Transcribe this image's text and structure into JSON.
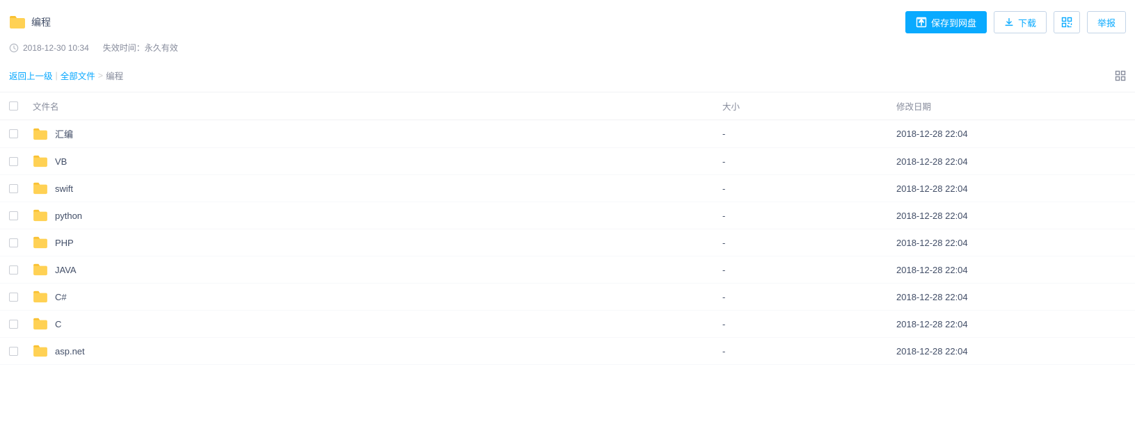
{
  "header": {
    "title": "编程",
    "shared_time": "2018-12-30 10:34",
    "expiry_label": "失效时间：永久有效"
  },
  "toolbar": {
    "save_label": "保存到网盘",
    "download_label": "下载",
    "report_label": "举报"
  },
  "breadcrumb": {
    "back_label": "返回上一级",
    "all_files_label": "全部文件",
    "current": "编程"
  },
  "columns": {
    "name": "文件名",
    "size": "大小",
    "date": "修改日期"
  },
  "files": [
    {
      "name": "汇编",
      "size": "-",
      "date": "2018-12-28 22:04"
    },
    {
      "name": "VB",
      "size": "-",
      "date": "2018-12-28 22:04"
    },
    {
      "name": "swift",
      "size": "-",
      "date": "2018-12-28 22:04"
    },
    {
      "name": "python",
      "size": "-",
      "date": "2018-12-28 22:04"
    },
    {
      "name": "PHP",
      "size": "-",
      "date": "2018-12-28 22:04"
    },
    {
      "name": "JAVA",
      "size": "-",
      "date": "2018-12-28 22:04"
    },
    {
      "name": "C#",
      "size": "-",
      "date": "2018-12-28 22:04"
    },
    {
      "name": "C",
      "size": "-",
      "date": "2018-12-28 22:04"
    },
    {
      "name": "asp.net",
      "size": "-",
      "date": "2018-12-28 22:04"
    }
  ]
}
